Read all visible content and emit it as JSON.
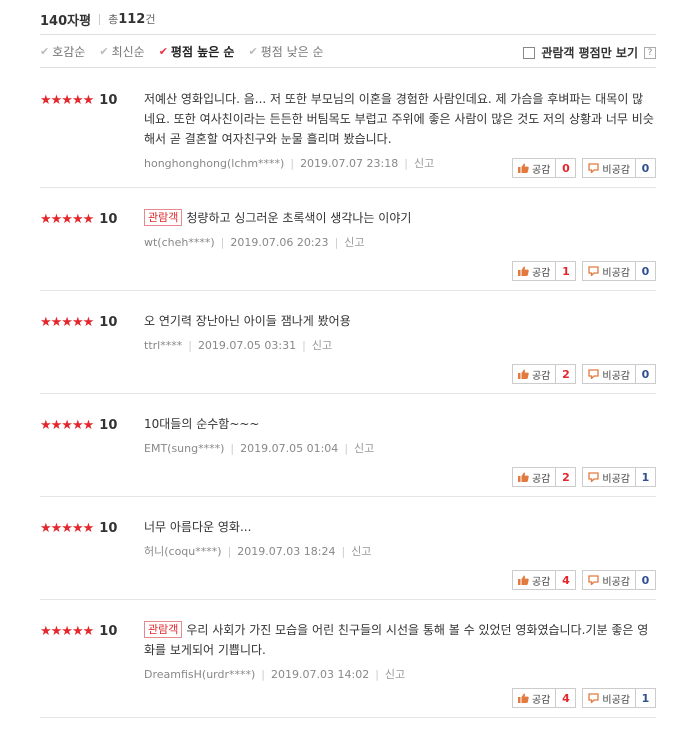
{
  "header": {
    "title": "140자평",
    "total_prefix": "총",
    "total_count": "112",
    "total_suffix": "건"
  },
  "sort": {
    "options": [
      "호감순",
      "최신순",
      "평점 높은 순",
      "평점 낮은 순"
    ],
    "active_index": 2,
    "audience_only_label": "관람객 평점만 보기",
    "help_label": "?"
  },
  "labels": {
    "like": "공감",
    "dislike": "비공감",
    "report": "신고",
    "audience": "관람객"
  },
  "reviews": [
    {
      "stars": 5,
      "score": "10",
      "audience": false,
      "text": "저예산 영화입니다. 음... 저 또한 부모님의 이혼을 경험한 사람인데요. 제 가슴을 후벼파는 대목이 많네요. 또한 여사친이라는 든든한 버팀목도 부럽고 주위에 좋은 사람이 많은 것도 저의 상황과 너무 비슷해서 곧 결혼할 여자친구와 눈물 흘리며 봤습니다.",
      "user": "honghonghong(lchm****)",
      "date": "2019.07.07 23:18",
      "likes": "0",
      "dislikes": "0"
    },
    {
      "stars": 5,
      "score": "10",
      "audience": true,
      "text": "청량하고 싱그러운 초록색이 생각나는 이야기",
      "user": "wt(cheh****)",
      "date": "2019.07.06 20:23",
      "likes": "1",
      "dislikes": "0"
    },
    {
      "stars": 5,
      "score": "10",
      "audience": false,
      "text": "오 연기력 장난아닌 아이들 잼나게 봤어용",
      "user": "ttrl****",
      "date": "2019.07.05 03:31",
      "likes": "2",
      "dislikes": "0"
    },
    {
      "stars": 5,
      "score": "10",
      "audience": false,
      "text": "10대들의 순수함~~~",
      "user": "EMT(sung****)",
      "date": "2019.07.05 01:04",
      "likes": "2",
      "dislikes": "1"
    },
    {
      "stars": 5,
      "score": "10",
      "audience": false,
      "text": "너무 아름다운 영화...",
      "user": "허니(coqu****)",
      "date": "2019.07.03 18:24",
      "likes": "4",
      "dislikes": "0"
    },
    {
      "stars": 5,
      "score": "10",
      "audience": true,
      "text": "우리 사회가 가진 모습을 어린 친구들의 시선을 통해 볼 수 있었던 영화였습니다.기분 좋은 영화를 보게되어 기쁩니다.",
      "user": "DreamfisH(urdr****)",
      "date": "2019.07.03 14:02",
      "likes": "4",
      "dislikes": "1"
    }
  ],
  "colors": {
    "accent": "#e3272c",
    "dislike_count": "#2f4f8f"
  }
}
